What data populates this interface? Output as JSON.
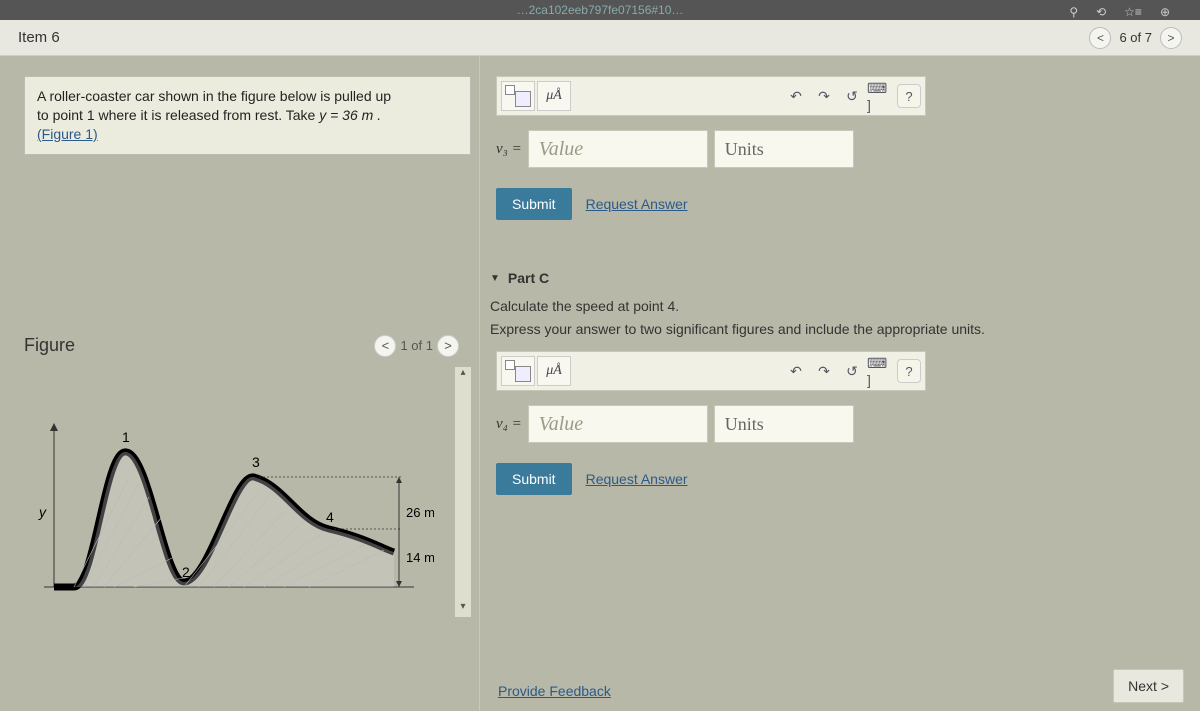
{
  "browser": {
    "url_fragment": "…2ca102eeb797fe07156#10…"
  },
  "page_nav": {
    "item_label": "Item 6",
    "position": "6 of 7"
  },
  "prompt": {
    "line1": "A roller-coaster car shown in the figure below is pulled up",
    "line2_a": "to point 1 where it is released from rest. Take ",
    "line2_b": "y = 36 m .",
    "figure_link": "(Figure 1)"
  },
  "figure": {
    "title": "Figure",
    "counter": "1 of 1",
    "labels": {
      "p1": "1",
      "p2": "2",
      "p3": "3",
      "p4": "4",
      "h26": "26 m",
      "h14": "14 m",
      "y": "y"
    }
  },
  "partB": {
    "var": "v₃ =",
    "value_placeholder": "Value",
    "units_placeholder": "Units",
    "submit": "Submit",
    "request": "Request Answer",
    "mu": "μÅ",
    "kbd": "⌨ ]",
    "help": "?"
  },
  "partC": {
    "header": "Part C",
    "text": "Calculate the speed at point 4.",
    "instr": "Express your answer to two significant figures and include the appropriate units.",
    "var": "v₄ =",
    "value_placeholder": "Value",
    "units_placeholder": "Units",
    "submit": "Submit",
    "request": "Request Answer",
    "mu": "μÅ",
    "kbd": "⌨ ]",
    "help": "?"
  },
  "footer": {
    "feedback": "Provide Feedback",
    "next": "Next >"
  }
}
